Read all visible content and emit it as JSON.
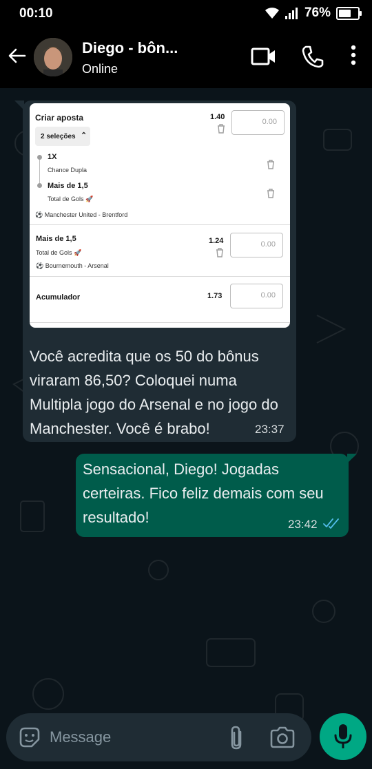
{
  "status_bar": {
    "time": "00:10",
    "battery": "76%",
    "battery_level": 0.76
  },
  "header": {
    "contact_name": "Diego - bôn...",
    "contact_status": "Online"
  },
  "bet_card": {
    "title": "Criar aposta",
    "selections_label": "2 seleções",
    "group_odd": "1.40",
    "stake_placeholder": "0.00",
    "selections": [
      {
        "name": "1X",
        "market": "Chance Dupla"
      },
      {
        "name": "Mais de 1,5",
        "market": "Total de Gols 🚀"
      }
    ],
    "group_match": "Manchester United  -  Brentford",
    "single": {
      "name": "Mais de 1,5",
      "market": "Total de Gols 🚀",
      "match": "Bournemouth  -  Arsenal",
      "odd": "1.24"
    },
    "accumulator": {
      "label": "Acumulador",
      "odd": "1.73"
    }
  },
  "messages": {
    "incoming": {
      "text": " Você acredita que os 50 do bônus viraram 86,50? Coloquei numa Multipla jogo do Arsenal e no jogo do Manchester. Você é brabo!",
      "time": "23:37"
    },
    "outgoing": {
      "text": " Sensacional, Diego! Jogadas certeiras. Fico feliz demais com seu resultado!",
      "time": "23:42"
    }
  },
  "input": {
    "placeholder": "Message"
  },
  "colors": {
    "incoming_bubble": "#1f2c34",
    "outgoing_bubble": "#005c4b",
    "accent": "#00a884",
    "read_ticks": "#53bdeb"
  }
}
